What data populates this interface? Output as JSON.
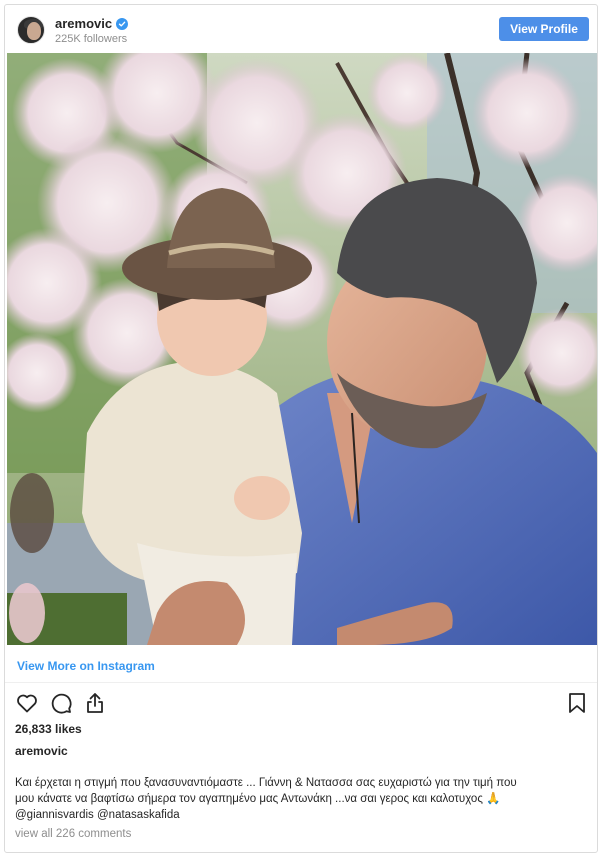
{
  "header": {
    "username": "aremovic",
    "followers": "225K followers",
    "view_profile_label": "View Profile"
  },
  "post": {
    "view_more_label": "View More on Instagram",
    "likes": "26,833 likes",
    "author": "aremovic",
    "caption_line1": "Και έρχεται η στιγμή που ξανασυναντιόμαστε ... Γιάννη & Νατασσα σας ευχαριστώ για την τιμή που",
    "caption_line2": "μου κάνατε να βαφτίσω σήμερα τον αγαπημένο μας Αντωνάκη ...να σαι γερος και καλοτυχος 🙏",
    "mention1": "@giannisvardis",
    "mention2": "@natasaskafida",
    "view_comments": "view all 226 comments"
  },
  "icons": {
    "like": "heart-icon",
    "comment": "comment-icon",
    "share": "share-icon",
    "save": "bookmark-icon",
    "verified": "verified-badge-icon"
  },
  "colors": {
    "link_blue": "#3897f0",
    "button_blue": "#4d8fe8",
    "text": "#262626",
    "muted": "#8e8e8e"
  }
}
